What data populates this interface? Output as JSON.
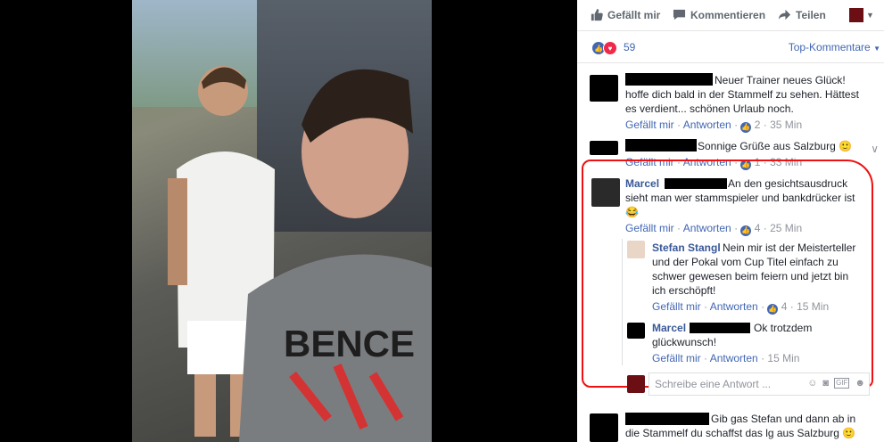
{
  "action_bar": {
    "like_label": "Gefällt mir",
    "comment_label": "Kommentieren",
    "share_label": "Teilen"
  },
  "reactions": {
    "count": "59",
    "sort_label": "Top-Kommentare"
  },
  "comments": [
    {
      "text": "Neuer Trainer neues Glück! hoffe dich bald in der Stammelf zu sehen. Hättest es verdient... schönen Urlaub noch.",
      "line1": "Neuer Trainer neues Glück!",
      "line2": "hoffe dich bald in der Stammelf zu sehen. Hättest",
      "line3": "es verdient... schönen Urlaub noch.",
      "like": "Gefällt mir",
      "reply": "Antworten",
      "likes": "2",
      "time": "35 Min"
    },
    {
      "line1": "Sonnige Grüße aus Salzburg 🙂",
      "like": "Gefällt mir",
      "reply": "Antworten",
      "likes": "1",
      "time": "33 Min"
    },
    {
      "name": "Marcel",
      "line1": "An den gesichtsausdruck",
      "line2": "sieht man wer stammspieler und bankdrücker ist",
      "line3": "😂",
      "like": "Gefällt mir",
      "reply": "Antworten",
      "likes": "4",
      "time": "25 Min"
    },
    {
      "name": "Stefan Stangl",
      "line1": "Nein mir ist der Meisterteller",
      "line2": "und der Pokal vom Cup Titel einfach zu",
      "line3": "schwer gewesen beim feiern und jetzt bin",
      "line4": "ich erschöpft!",
      "like": "Gefällt mir",
      "reply": "Antworten",
      "likes": "4",
      "time": "15 Min"
    },
    {
      "name": "Marcel",
      "line1": "Ok trotzdem",
      "line2": "glückwunsch!",
      "like": "Gefällt mir",
      "reply": "Antworten",
      "time": "15 Min"
    },
    {
      "line1": "Gib gas Stefan und dann ab in",
      "line2": "die Stammelf du schaffst das lg aus Salzburg 🙂"
    }
  ],
  "reply_box": {
    "placeholder": "Schreibe eine Antwort ..."
  },
  "colors": {
    "link": "#4267b2",
    "name": "#385898",
    "highlight": "#e11111"
  }
}
